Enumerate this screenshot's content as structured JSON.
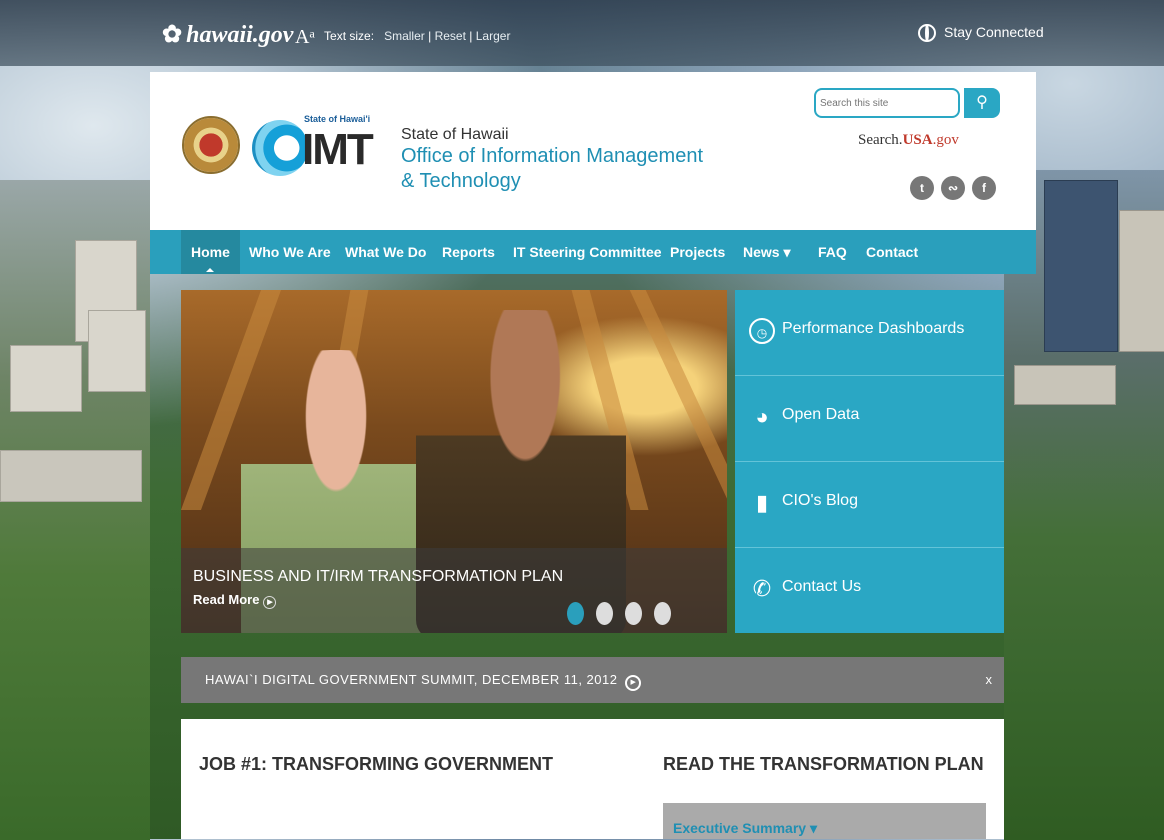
{
  "topbar": {
    "logo": "hawaii.gov",
    "text_size_label": "Text size:",
    "smaller": "Smaller",
    "reset": "Reset",
    "larger": "Larger",
    "separator": "|",
    "stay_connected": "Stay Connected"
  },
  "header": {
    "imt_small": "State of Hawai'i",
    "imt_big": "IMT",
    "org_line1": "State of Hawaii",
    "org_line2": "Office of Information Management & Technology",
    "search_placeholder": "Search this site",
    "search_icon": "search-icon",
    "usagov_prefix": "Search.",
    "usagov_mid": "USA",
    "usagov_suffix": ".gov",
    "social": [
      "twitter-icon",
      "rss-icon",
      "facebook-icon"
    ]
  },
  "nav": {
    "items": [
      {
        "label": "Home",
        "active": true
      },
      {
        "label": "Who We Are"
      },
      {
        "label": "What We Do"
      },
      {
        "label": "Reports"
      },
      {
        "label": "IT Steering Committee"
      },
      {
        "label": "Projects"
      },
      {
        "label": "News ▾"
      },
      {
        "label": "FAQ"
      },
      {
        "label": "Contact"
      }
    ]
  },
  "hero": {
    "caption": "BUSINESS AND IT/IRM TRANSFORMATION PLAN",
    "read_more": "Read More",
    "slides": 4,
    "active_slide": 1
  },
  "tiles": [
    {
      "label": "Performance Dashboards",
      "icon": "clock-icon"
    },
    {
      "label": "Open Data",
      "icon": "pie-chart-icon"
    },
    {
      "label": "CIO's Blog",
      "icon": "speech-bubble-icon"
    },
    {
      "label": "Contact Us",
      "icon": "phone-icon"
    }
  ],
  "news": {
    "text": "HAWAI`I DIGITAL GOVERNMENT SUMMIT, DECEMBER 11, 2012",
    "close": "x"
  },
  "content": {
    "left_heading": "JOB #1: TRANSFORMING GOVERNMENT",
    "right_heading": "READ THE TRANSFORMATION PLAN",
    "exec_summary": "Executive Summary  ▾"
  },
  "colors": {
    "accent": "#2a9fbc",
    "tile": "#2aa7c4",
    "banner": "#777777"
  }
}
